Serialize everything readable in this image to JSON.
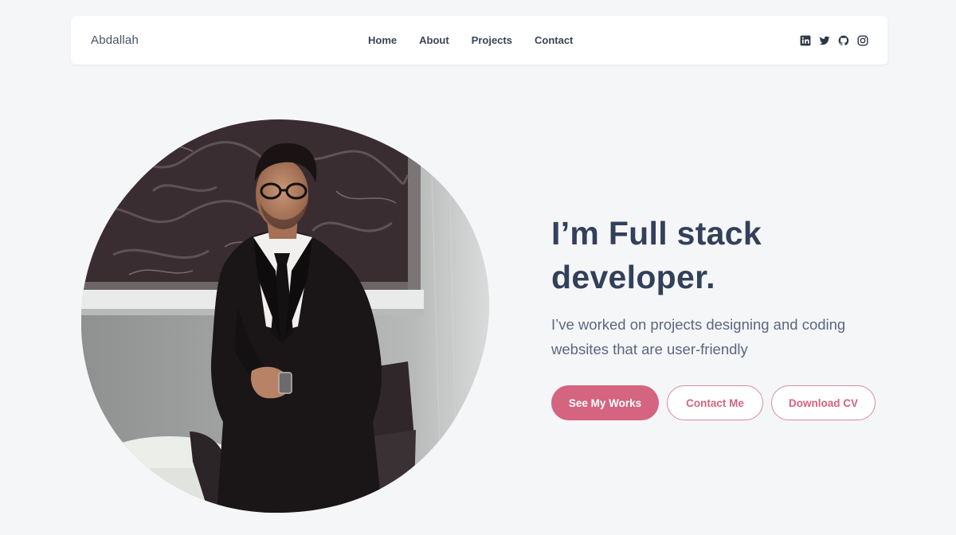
{
  "header": {
    "brand": "Abdallah",
    "nav": [
      {
        "label": "Home"
      },
      {
        "label": "About"
      },
      {
        "label": "Projects"
      },
      {
        "label": "Contact"
      }
    ],
    "socials": [
      "linkedin-icon",
      "twitter-icon",
      "github-icon",
      "instagram-icon"
    ]
  },
  "hero": {
    "title_line1": "I’m Full stack",
    "title_line2": "developer.",
    "subtitle": "I’ve worked on projects designing and coding websites that are user-friendly",
    "buttons": {
      "primary": "See My Works",
      "contact": "Contact Me",
      "cv": "Download CV"
    }
  },
  "colors": {
    "accent": "#d4647f",
    "heading": "#33405a",
    "text": "#5b6680",
    "background": "#f5f6f8"
  }
}
